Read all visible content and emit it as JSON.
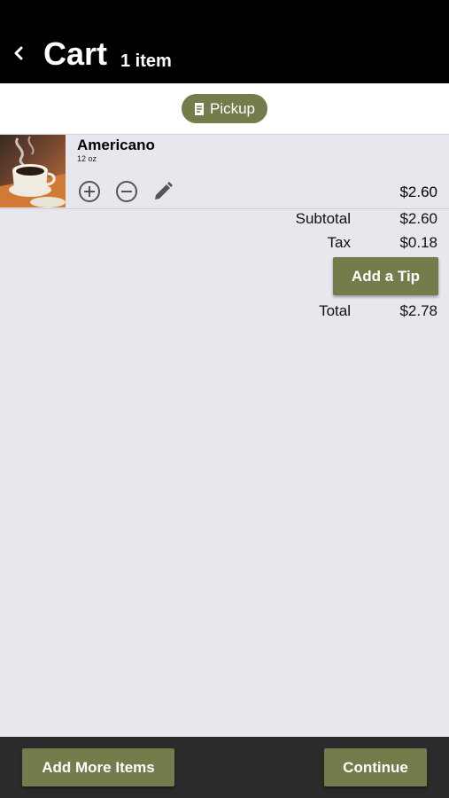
{
  "header": {
    "title": "Cart",
    "item_count": "1 item",
    "back_icon": "chevron-left-icon"
  },
  "order_mode": {
    "label": "Pickup",
    "icon": "receipt-icon"
  },
  "cart": {
    "items": [
      {
        "name": "Americano",
        "size": "12 oz",
        "price": "$2.60",
        "image": "coffee-cup-photo"
      }
    ]
  },
  "summary": {
    "subtotal_label": "Subtotal",
    "subtotal_value": "$2.60",
    "tax_label": "Tax",
    "tax_value": "$0.18",
    "tip_button": "Add a Tip",
    "total_label": "Total",
    "total_value": "$2.78"
  },
  "footer": {
    "add_more_label": "Add More Items",
    "continue_label": "Continue"
  },
  "colors": {
    "accent": "#747c4c",
    "header_bg": "#000000",
    "page_bg": "#e8e7ee",
    "footer_bg": "#2b2b2b"
  }
}
